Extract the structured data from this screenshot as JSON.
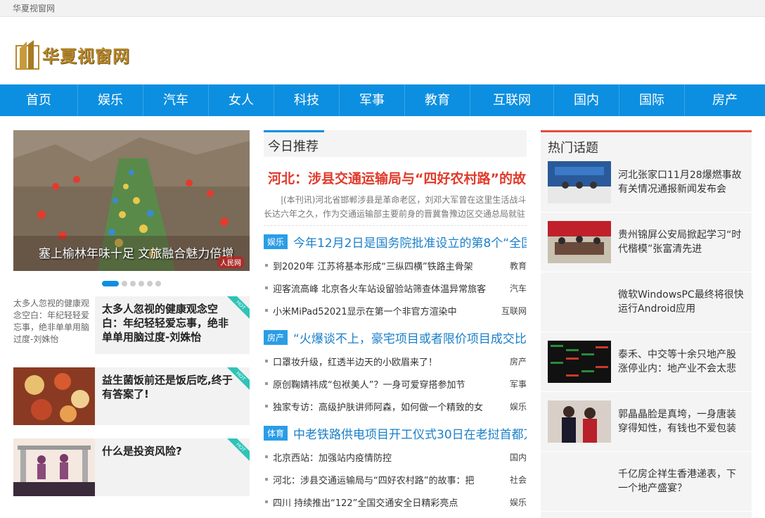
{
  "topbar": {
    "site_name": "华夏视窗网"
  },
  "logo": {
    "text": "华夏视窗网"
  },
  "nav": [
    "首页",
    "娱乐",
    "汽车",
    "女人",
    "科技",
    "军事",
    "教育",
    "互联网",
    "国内",
    "国际",
    "房产"
  ],
  "slider": {
    "caption": "塞上榆林年味十足 文旅融合魅力倍增",
    "stamp": "人民网"
  },
  "cards": [
    {
      "title": "太多人忽视的健康观念空白：年纪轻轻爱忘事，绝非单单用脑过度-刘姝怡",
      "alt": "太多人忽视的健康观念空白：年纪轻轻爱忘事，绝非单单用脑过度-刘姝怡",
      "badge": "HOT"
    },
    {
      "title": "益生菌饭前还是饭后吃,终于有答案了!",
      "badge": "HOT"
    },
    {
      "title": "什么是投资风险?",
      "badge": "HOT"
    }
  ],
  "today": {
    "heading": "今日推荐",
    "lead_title": "河北：涉县交通运输局与“四好农村路”的故",
    "lead_desc": "|(本刊讯)河北省邯郸涉县是革命老区，刘邓大军曾在这里生活战斗长达六年之久，作为交通运输部主要前身的晋冀鲁豫边区交通总局就驻",
    "sections": [
      {
        "tag": "娱乐",
        "title": "今年12月2日是国务院批准设立的第8个“全国",
        "items": [
          {
            "text": "到2020年 江苏将基本形成“三纵四横”铁路主骨架",
            "cat": "教育"
          },
          {
            "text": "迎客流高峰 北京各火车站设留验站筛查体温异常旅客",
            "cat": "汽车"
          },
          {
            "text": "小米MiPad52021显示在第一个非官方渲染中",
            "cat": "互联网"
          }
        ]
      },
      {
        "tag": "房产",
        "title": "“火爆谈不上，豪宅项目或者限价项目成交比",
        "items": [
          {
            "text": "口罩妆升级，红透半边天的小欧眉来了！",
            "cat": "房产"
          },
          {
            "text": "原创鞠婧祎成“包袱美人”？一身可爱穿搭参加节",
            "cat": "军事"
          },
          {
            "text": "独家专访：高级护肤讲师阿森，如何做一个精致的女",
            "cat": "娱乐"
          }
        ]
      },
      {
        "tag": "体育",
        "title": "中老铁路供电项目开工仪式30日在老挝首都万",
        "items": [
          {
            "text": "北京西站：加强站内疫情防控",
            "cat": "国内"
          },
          {
            "text": "河北：涉县交通运输局与“四好农村路”的故事：把",
            "cat": "社会"
          },
          {
            "text": "四川 持续推出“122”全国交通安全日精彩亮点",
            "cat": "娱乐"
          }
        ]
      }
    ]
  },
  "hot_topics": {
    "heading": "热门话题",
    "items": [
      {
        "text": "河北张家口11月28爆燃事故有关情况通报新闻发布会",
        "has_image": true
      },
      {
        "text": "贵州锦屏公安局掀起学习“时代楷模”张富清先进",
        "has_image": true
      },
      {
        "text": "微软WindowsPC最终将很快运行Android应用",
        "has_image": false
      },
      {
        "text": "泰禾、中交等十余只地产股涨停业内：地产业不会太悲",
        "has_image": true
      },
      {
        "text": "郭晶晶脸是真垮，一身唐装穿得知性，有钱也不爱包装",
        "has_image": true
      },
      {
        "text": "千亿房企祥生香港递表，下一个地产盛宴？",
        "has_image": false
      }
    ]
  }
}
